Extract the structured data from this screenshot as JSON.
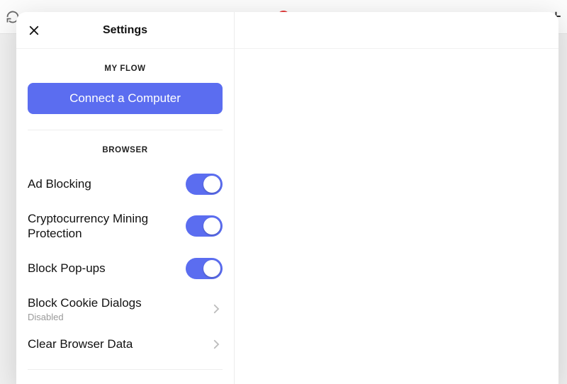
{
  "header": {
    "title": "Settings"
  },
  "myflow": {
    "section_label": "MY FLOW",
    "connect_label": "Connect a Computer"
  },
  "browser": {
    "section_label": "BROWSER",
    "items": [
      {
        "label": "Ad Blocking",
        "type": "toggle",
        "on": true
      },
      {
        "label": "Cryptocurrency Mining Protection",
        "type": "toggle",
        "on": true
      },
      {
        "label": "Block Pop-ups",
        "type": "toggle",
        "on": true
      },
      {
        "label": "Block Cookie Dialogs",
        "type": "link",
        "sub": "Disabled"
      },
      {
        "label": "Clear Browser Data",
        "type": "link"
      }
    ]
  },
  "colors": {
    "accent": "#5b6df0"
  }
}
